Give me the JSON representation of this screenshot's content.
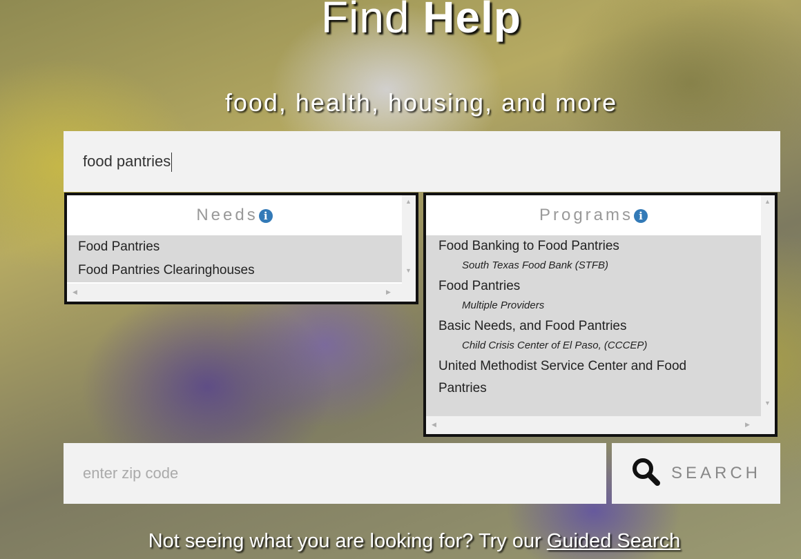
{
  "hero": {
    "title_light": "Find",
    "title_bold": "Help",
    "subtitle": "food, health, housing, and more"
  },
  "search": {
    "value": "food pantries"
  },
  "needs": {
    "header": "Needs",
    "items": [
      "Food Pantries",
      "Food Pantries Clearinghouses"
    ]
  },
  "programs": {
    "header": "Programs",
    "items": [
      {
        "name": "Food Banking to Food Pantries",
        "provider": "South Texas Food Bank (STFB)"
      },
      {
        "name": "Food Pantries",
        "provider": "Multiple Providers"
      },
      {
        "name": "Basic Needs, and Food Pantries",
        "provider": "Child Crisis Center of El Paso, (CCCEP)"
      },
      {
        "name_line1": "United Methodist Service Center and Food",
        "name_line2": "Pantries"
      }
    ]
  },
  "zip": {
    "placeholder": "enter zip code"
  },
  "search_button": {
    "label": "SEARCH",
    "icon": "magnifier-icon"
  },
  "footer": {
    "text": "Not seeing what you are looking for? Try our",
    "link": "Guided Search"
  },
  "info_icon_glyph": "i"
}
